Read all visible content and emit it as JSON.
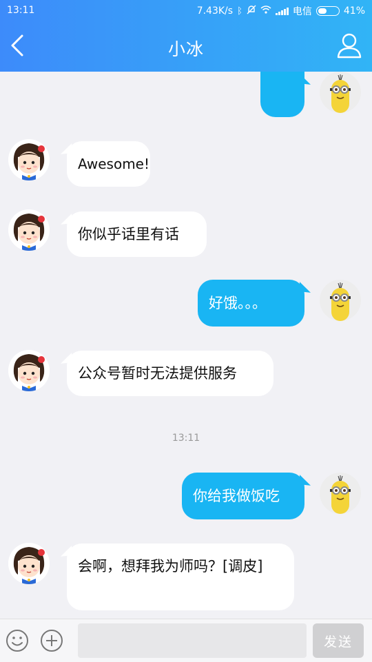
{
  "status_bar": {
    "time": "13:11",
    "network_speed": "7.43K/s",
    "carrier": "电信",
    "battery": "41%",
    "battery_level": 0.41
  },
  "header": {
    "title": "小冰",
    "back_icon": "chevron-left-icon",
    "profile_icon": "person-icon"
  },
  "messages": [
    {
      "sender": "me",
      "text": ""
    },
    {
      "sender": "bot",
      "text": "Awesome!"
    },
    {
      "sender": "bot",
      "text": "你似乎话里有话"
    },
    {
      "sender": "me",
      "text": "好饿。。。"
    },
    {
      "sender": "bot",
      "text": "公众号暂时无法提供服务"
    },
    {
      "sender": "me",
      "text": "你给我做饭吃"
    },
    {
      "sender": "bot",
      "text": "会啊，想拜我为师吗？[调皮]"
    }
  ],
  "timestamp_divider": "13:11",
  "input_bar": {
    "emoji_icon": "smiley-icon",
    "plus_icon": "plus-circle-icon",
    "input_value": "",
    "send_label": "发送"
  },
  "colors": {
    "header_start": "#3d8bfa",
    "header_end": "#31b4f6",
    "my_bubble": "#19b5f3",
    "bot_bubble": "#ffffff",
    "background": "#f1f1f5"
  }
}
